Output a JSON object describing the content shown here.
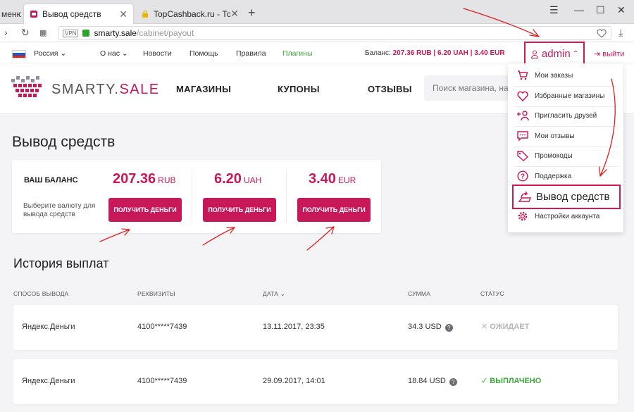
{
  "browser": {
    "prev_tab_label": "меню",
    "active_tab_label": "Вывод средств",
    "inactive_tab_label": "TopCashback.ru - Топ лучш",
    "address": {
      "vpn_label": "VPN",
      "host": "smarty.sale",
      "path": "/cabinet/payout"
    }
  },
  "topbar": {
    "region": "Россия",
    "links": [
      "О нас",
      "Новости",
      "Помощь",
      "Правила",
      "Плагины"
    ],
    "balance_label": "Баланс:",
    "balance_values": "207.36 RUB | 6.20 UAH | 3.40 EUR",
    "user": "admin",
    "logout": "выйти"
  },
  "header": {
    "logo_part1": "SMARTY.",
    "logo_part2": "SALE",
    "nav": [
      "МАГАЗИНЫ",
      "КУПОНЫ",
      "ОТЗЫВЫ"
    ],
    "search_placeholder": "Поиск магазина, на"
  },
  "dropdown": {
    "items": [
      {
        "label": "Мои заказы",
        "icon": "cart-icon"
      },
      {
        "label": "Избранные магазины",
        "icon": "heart-icon"
      },
      {
        "label": "Пригласить друзей",
        "icon": "add-user-icon"
      },
      {
        "label": "Мои отзывы",
        "icon": "comment-icon"
      },
      {
        "label": "Промокоды",
        "icon": "tag-icon"
      },
      {
        "label": "Поддержка",
        "icon": "help-icon"
      },
      {
        "label": "Вывод средств",
        "icon": "wallet-icon"
      },
      {
        "label": "Настройки аккаунта",
        "icon": "gear-icon"
      }
    ]
  },
  "page": {
    "title": "Вывод средств",
    "balance_label": "ВАШ БАЛАНС",
    "hint": "Выберите валюту для вывода средств",
    "currencies": [
      {
        "amount": "207.36",
        "currency": "RUB",
        "button": "ПОЛУЧИТЬ ДЕНЬГИ"
      },
      {
        "amount": "6.20",
        "currency": "UAH",
        "button": "ПОЛУЧИТЬ ДЕНЬГИ"
      },
      {
        "amount": "3.40",
        "currency": "EUR",
        "button": "ПОЛУЧИТЬ ДЕНЬГИ"
      }
    ]
  },
  "history": {
    "title": "История выплат",
    "columns": [
      "СПОСОБ ВЫВОДА",
      "РЕКВИЗИТЫ",
      "ДАТА",
      "СУММА",
      "СТАТУС"
    ],
    "rows": [
      {
        "method": "Яндекс.Деньги",
        "details": "4100*****7439",
        "date": "13.11.2017, 23:35",
        "amount": "34.3 USD",
        "status": "ОЖИДАЕТ",
        "status_color": "#b5b5b5"
      },
      {
        "method": "Яндекс.Деньги",
        "details": "4100*****7439",
        "date": "29.09.2017, 14:01",
        "amount": "18.84 USD",
        "status": "ВЫПЛАЧЕНО",
        "status_color": "#3aaa35"
      }
    ]
  },
  "colors": {
    "accent": "#c8185a",
    "highlight": "#d8174f",
    "success": "#3aaa35"
  }
}
